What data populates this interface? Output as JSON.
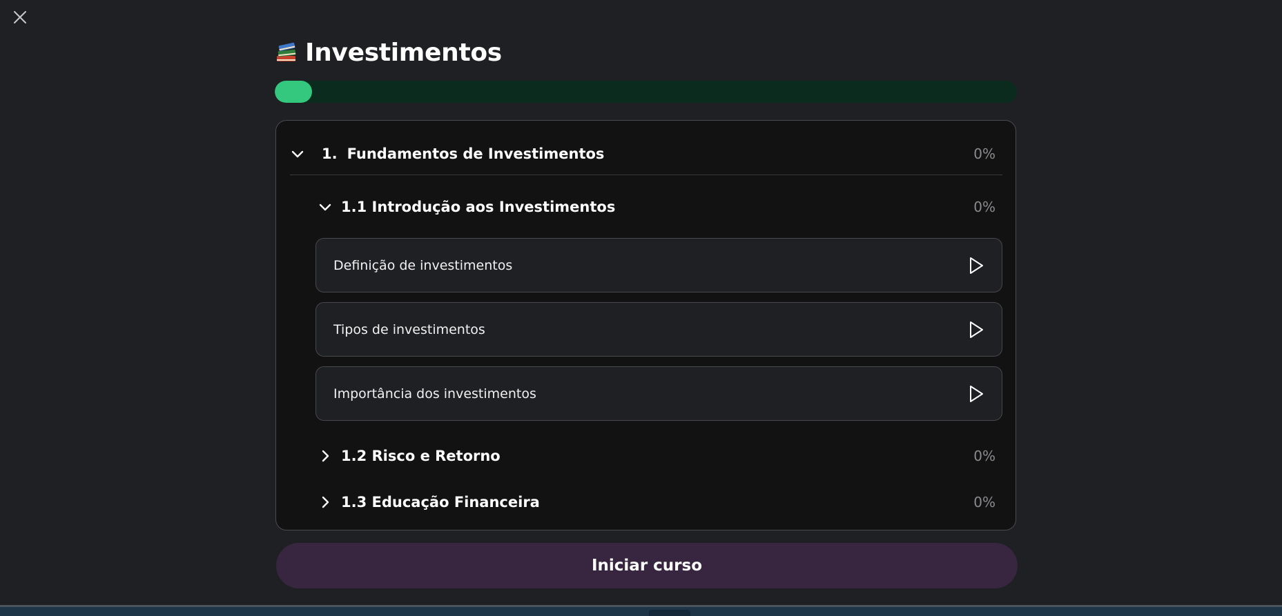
{
  "header": {
    "close_icon": "close-icon",
    "title_icon": "books-emoji-icon",
    "title": "Investimentos"
  },
  "progress": {
    "fraction": 0.05,
    "fill_color": "#34c77e",
    "track_color": "#0b2b1e"
  },
  "module": {
    "number": "1.",
    "title": "Fundamentos de Investimentos",
    "percent": "0%",
    "expanded": true
  },
  "lessons": [
    {
      "title": "1.1 Introdução aos Investimentos",
      "percent": "0%",
      "expanded": true,
      "topics": [
        {
          "label": "Definição de investimentos",
          "icon": "play-icon"
        },
        {
          "label": "Tipos de investimentos",
          "icon": "play-icon"
        },
        {
          "label": "Importância dos investimentos",
          "icon": "play-icon"
        }
      ]
    },
    {
      "title": "1.2 Risco e Retorno",
      "percent": "0%",
      "expanded": false
    },
    {
      "title": "1.3 Educação Financeira",
      "percent": "0%",
      "expanded": false
    }
  ],
  "footer": {
    "start_label": "Iniciar curso"
  },
  "colors": {
    "background": "#1f2023",
    "panel": "#121212",
    "start_button": "#382640"
  }
}
